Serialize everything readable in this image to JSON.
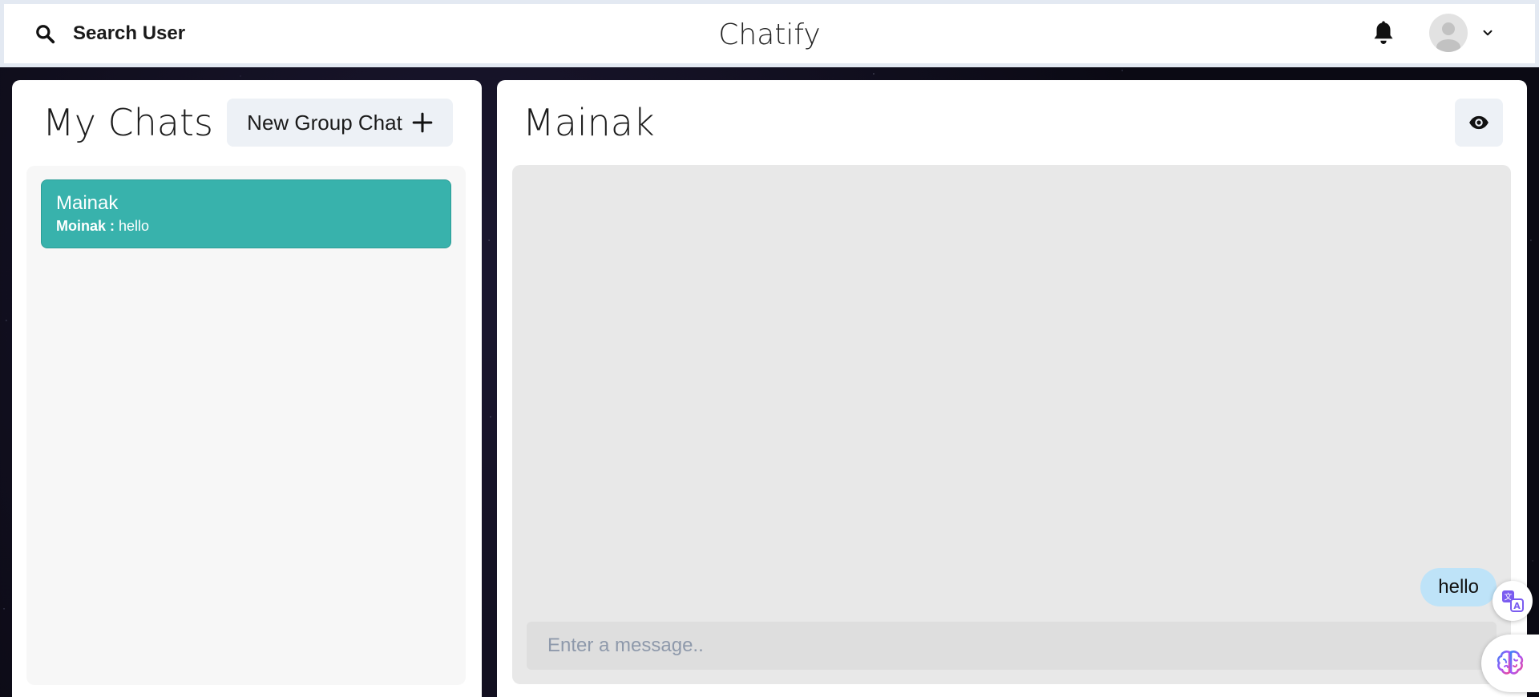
{
  "header": {
    "search_label": "Search User",
    "app_title": "Chatify",
    "icons": {
      "search": "search-icon",
      "notifications": "bell-icon",
      "avatar": "user-avatar-icon",
      "menu": "chevron-down-icon"
    }
  },
  "sidebar": {
    "title": "My Chats",
    "new_group_label": "New Group Chat",
    "chats": [
      {
        "name": "Mainak",
        "sender": "Moinak :",
        "preview": "hello",
        "selected": true
      }
    ]
  },
  "chat": {
    "title": "Mainak",
    "messages": [
      {
        "text": "hello",
        "own": true
      }
    ],
    "input_placeholder": "Enter a message.."
  },
  "colors": {
    "accent": "#38b2ac",
    "bubble": "#bee3f8",
    "button_bg": "#edf1f6",
    "messages_bg": "#e8e8e8"
  }
}
